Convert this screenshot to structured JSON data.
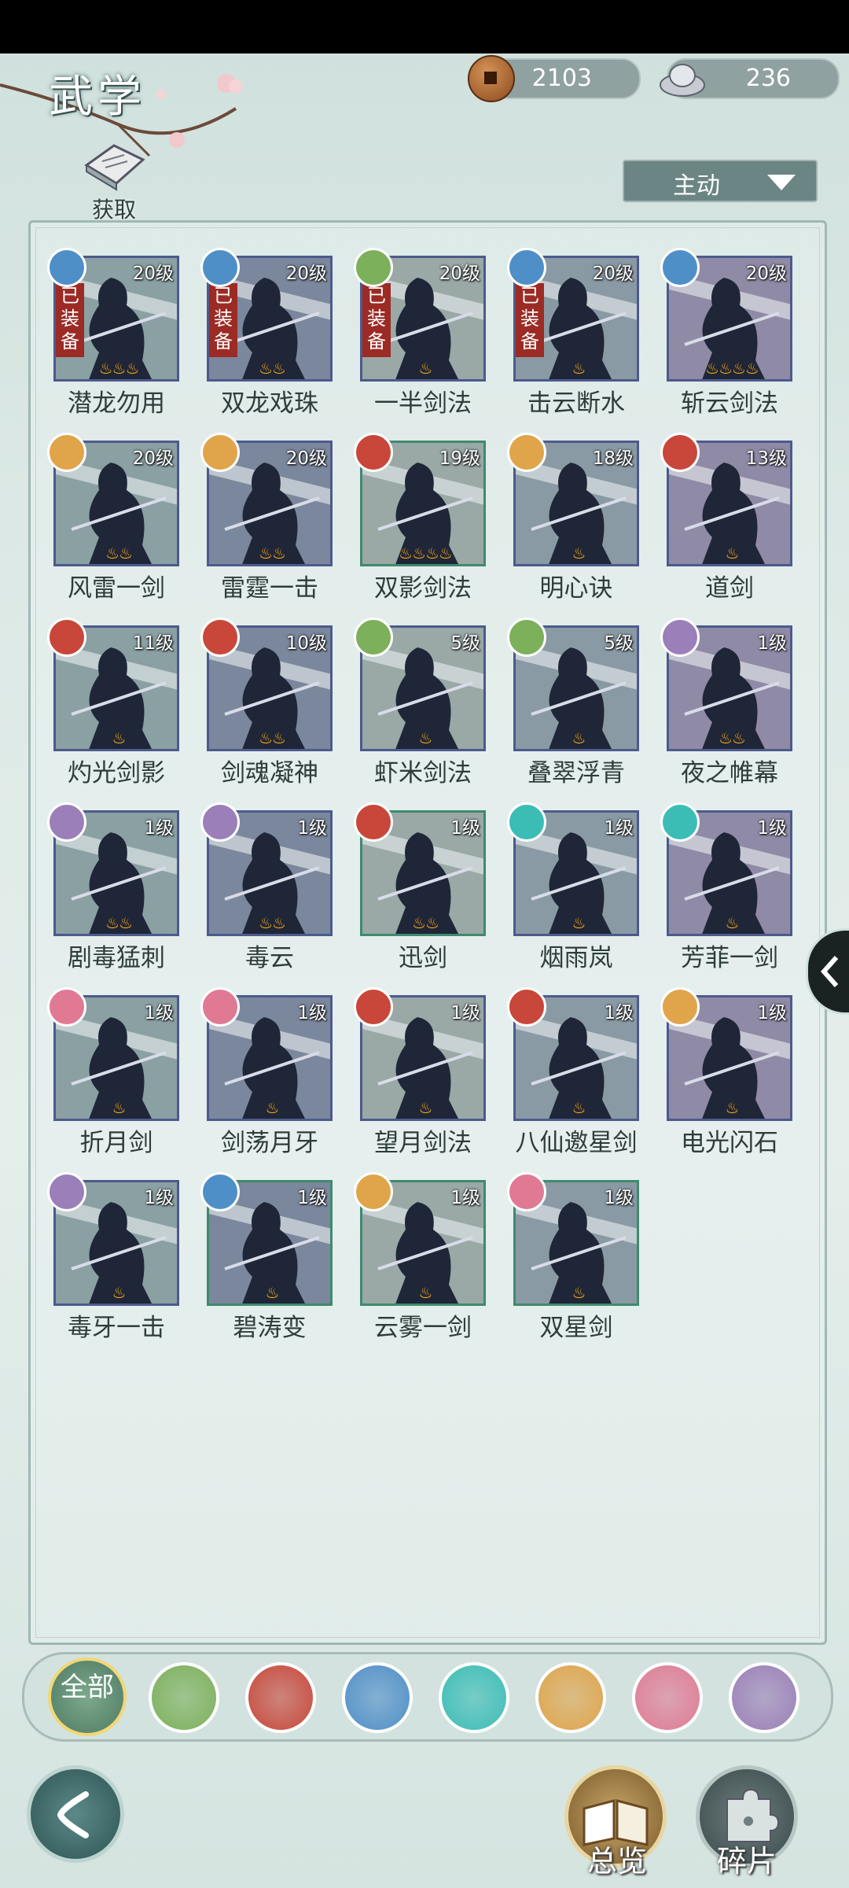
{
  "header": {
    "title": "武学",
    "get_label": "获取"
  },
  "currencies": {
    "copper": "2103",
    "silver": "236"
  },
  "filter": {
    "selected": "主动"
  },
  "colors": {
    "wind": "#4f8fc8",
    "earth": "#e0a44a",
    "fire": "#c8473a",
    "leaf": "#7cb05a",
    "poison": "#9b7fb8",
    "butterfly": "#3bbdb6",
    "moon": "#e07a94"
  },
  "skills": [
    {
      "name": "潜龙勿用",
      "level": "20级",
      "equipped": "已装备",
      "element": "wind",
      "stars": "♨♨♨",
      "frame": "blue"
    },
    {
      "name": "双龙戏珠",
      "level": "20级",
      "equipped": "已装备",
      "element": "wind",
      "stars": "♨♨",
      "frame": "blue"
    },
    {
      "name": "一半剑法",
      "level": "20级",
      "equipped": "已装备",
      "element": "leaf",
      "stars": "♨",
      "frame": "blue"
    },
    {
      "name": "击云断水",
      "level": "20级",
      "equipped": "已装备",
      "element": "wind",
      "stars": "♨",
      "frame": "blue"
    },
    {
      "name": "斩云剑法",
      "level": "20级",
      "equipped": "",
      "element": "wind",
      "stars": "♨♨♨♨",
      "frame": "blue"
    },
    {
      "name": "风雷一剑",
      "level": "20级",
      "equipped": "",
      "element": "earth",
      "stars": "♨♨",
      "frame": "blue"
    },
    {
      "name": "雷霆一击",
      "level": "20级",
      "equipped": "",
      "element": "earth",
      "stars": "♨♨",
      "frame": "blue"
    },
    {
      "name": "双影剑法",
      "level": "19级",
      "equipped": "",
      "element": "fire",
      "stars": "♨♨♨♨",
      "frame": "green"
    },
    {
      "name": "明心诀",
      "level": "18级",
      "equipped": "",
      "element": "earth",
      "stars": "♨",
      "frame": "blue"
    },
    {
      "name": "道剑",
      "level": "13级",
      "equipped": "",
      "element": "fire",
      "stars": "♨",
      "frame": "blue"
    },
    {
      "name": "灼光剑影",
      "level": "11级",
      "equipped": "",
      "element": "fire",
      "stars": "♨",
      "frame": "blue"
    },
    {
      "name": "剑魂凝神",
      "level": "10级",
      "equipped": "",
      "element": "fire",
      "stars": "♨♨",
      "frame": "blue"
    },
    {
      "name": "虾米剑法",
      "level": "5级",
      "equipped": "",
      "element": "leaf",
      "stars": "♨",
      "frame": "blue"
    },
    {
      "name": "叠翠浮青",
      "level": "5级",
      "equipped": "",
      "element": "leaf",
      "stars": "♨",
      "frame": "blue"
    },
    {
      "name": "夜之帷幕",
      "level": "1级",
      "equipped": "",
      "element": "poison",
      "stars": "♨♨",
      "frame": "blue"
    },
    {
      "name": "剧毒猛刺",
      "level": "1级",
      "equipped": "",
      "element": "poison",
      "stars": "♨♨",
      "frame": "blue"
    },
    {
      "name": "毒云",
      "level": "1级",
      "equipped": "",
      "element": "poison",
      "stars": "♨♨",
      "frame": "blue"
    },
    {
      "name": "迅剑",
      "level": "1级",
      "equipped": "",
      "element": "fire",
      "stars": "♨♨",
      "frame": "green"
    },
    {
      "name": "烟雨岚",
      "level": "1级",
      "equipped": "",
      "element": "butterfly",
      "stars": "♨",
      "frame": "blue"
    },
    {
      "name": "芳菲一剑",
      "level": "1级",
      "equipped": "",
      "element": "butterfly",
      "stars": "♨",
      "frame": "blue"
    },
    {
      "name": "折月剑",
      "level": "1级",
      "equipped": "",
      "element": "moon",
      "stars": "♨",
      "frame": "blue"
    },
    {
      "name": "剑荡月牙",
      "level": "1级",
      "equipped": "",
      "element": "moon",
      "stars": "♨",
      "frame": "blue"
    },
    {
      "name": "望月剑法",
      "level": "1级",
      "equipped": "",
      "element": "fire",
      "stars": "♨",
      "frame": "blue"
    },
    {
      "name": "八仙邀星剑",
      "level": "1级",
      "equipped": "",
      "element": "fire",
      "stars": "♨",
      "frame": "blue"
    },
    {
      "name": "电光闪石",
      "level": "1级",
      "equipped": "",
      "element": "earth",
      "stars": "♨",
      "frame": "blue"
    },
    {
      "name": "毒牙一击",
      "level": "1级",
      "equipped": "",
      "element": "poison",
      "stars": "♨",
      "frame": "blue"
    },
    {
      "name": "碧涛变",
      "level": "1级",
      "equipped": "",
      "element": "wind",
      "stars": "♨",
      "frame": "green"
    },
    {
      "name": "云雾一剑",
      "level": "1级",
      "equipped": "",
      "element": "earth",
      "stars": "♨",
      "frame": "green"
    },
    {
      "name": "双星剑",
      "level": "1级",
      "equipped": "",
      "element": "moon",
      "stars": "♨",
      "frame": "green"
    }
  ],
  "element_filter": {
    "all_label": "全部",
    "items": [
      "leaf",
      "fire",
      "wind",
      "butterfly",
      "earth",
      "moon",
      "poison"
    ]
  },
  "bottom": {
    "overview_label": "总览",
    "fragments_label": "碎片"
  }
}
